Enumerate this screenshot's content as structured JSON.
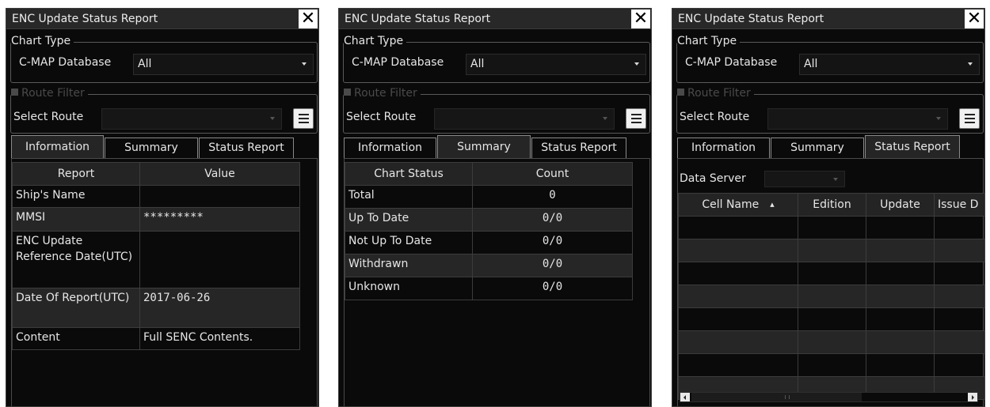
{
  "title": "ENC Update Status Report",
  "close_glyph": "✕",
  "chart_type": {
    "legend": "Chart Type",
    "label": "C-MAP Database",
    "value": "All"
  },
  "route_filter": {
    "legend": "Route Filter",
    "enabled": false,
    "select_label": "Select Route",
    "select_value": ""
  },
  "tabs": [
    "Information",
    "Summary",
    "Status Report"
  ],
  "information": {
    "headers": [
      "Report",
      "Value"
    ],
    "rows": [
      {
        "label": "Ship's Name",
        "value": ""
      },
      {
        "label": "MMSI",
        "value": "*********"
      },
      {
        "label": "ENC Update Reference Date(UTC)",
        "value": ""
      },
      {
        "label": "Date Of Report(UTC)",
        "value": "2017-06-26"
      },
      {
        "label": "Content",
        "value": "Full SENC Contents."
      }
    ]
  },
  "summary": {
    "headers": [
      "Chart Status",
      "Count"
    ],
    "rows": [
      {
        "label": "Total",
        "value": "0"
      },
      {
        "label": "Up To Date",
        "value": "0/0"
      },
      {
        "label": "Not Up To Date",
        "value": "0/0"
      },
      {
        "label": "Withdrawn",
        "value": "0/0"
      },
      {
        "label": "Unknown",
        "value": "0/0"
      }
    ]
  },
  "status_report": {
    "data_server_label": "Data Server",
    "data_server_value": "",
    "headers": [
      "Cell Name",
      "Edition",
      "Update",
      "Issue D"
    ],
    "sort_column": "Cell Name",
    "sort_indicator": "▲",
    "scroll_grip": "III"
  },
  "colors": {
    "panel_bg": "#0a0a0a",
    "titlebar_bg": "#282828",
    "header_bg": "#242424",
    "alt_row_bg": "#262626",
    "text": "#e6e6e6",
    "close_button_bg": "#ffffff"
  }
}
